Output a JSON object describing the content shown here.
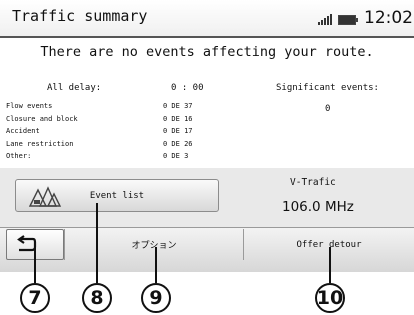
{
  "header": {
    "title": "Traffic summary",
    "time": "12:02",
    "signal_icon": "signal-bars-icon",
    "battery_icon": "battery-icon"
  },
  "summary": {
    "headline": "There are no events affecting your route.",
    "all_delay_label": "All delay:",
    "all_delay_value": "0 : 00",
    "significant_label": "Significant events:",
    "significant_value": "0"
  },
  "events": [
    {
      "label": "Flow events",
      "value": "0 DE 37"
    },
    {
      "label": "Closure and block",
      "value": "0 DE 16"
    },
    {
      "label": "Accident",
      "value": "0 DE 17"
    },
    {
      "label": "Lane restriction",
      "value": "0 DE 26"
    },
    {
      "label": "Other:",
      "value": "0 DE 3"
    }
  ],
  "event_list_button": {
    "label": "Event list",
    "icon": "traffic-event-icon"
  },
  "source": {
    "name": "V-Trafic",
    "frequency": "106.0 MHz"
  },
  "bottom": {
    "back_icon": "back-arrow-icon",
    "options_label": "オプション",
    "detour_label": "Offer detour"
  },
  "callouts": [
    "7",
    "8",
    "9",
    "10"
  ]
}
